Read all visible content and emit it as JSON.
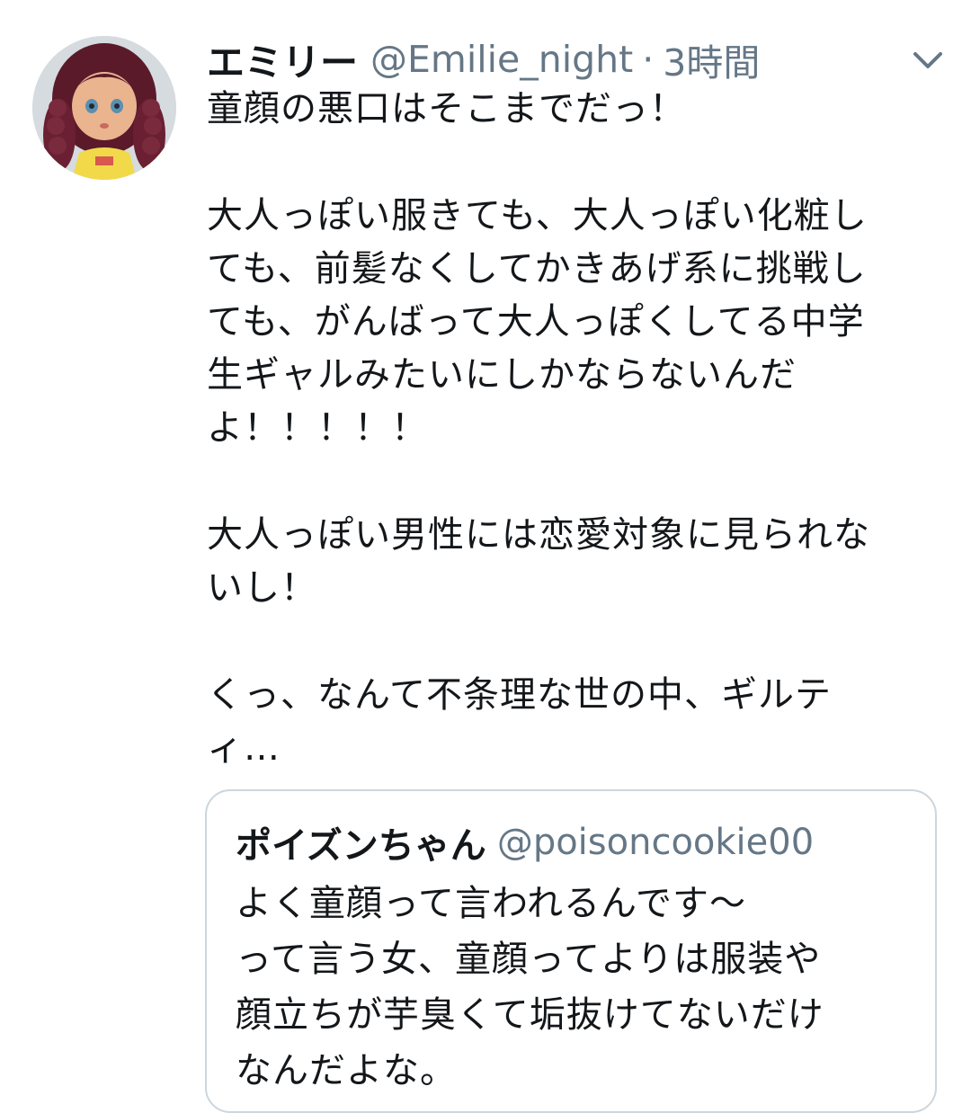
{
  "tweet": {
    "display_name": "エミリー",
    "handle": "@Emilie_night",
    "separator": "·",
    "time": "3時間",
    "avatar_icon": "doll-avatar",
    "menu_icon": "chevron-down-icon",
    "lines": [
      "童顔の悪口はそこまでだっ！",
      "",
      "大人っぽい服きても、大人っぽい化粧し",
      "ても、前髪なくしてかきあげ系に挑戦し",
      "ても、がんばって大人っぽくしてる中学",
      "生ギャルみたいにしかならないんだ",
      "よ！！！！！",
      "",
      "大人っぽい男性には恋愛対象に見られな",
      "いし！",
      "",
      "くっ、なんて不条理な世の中、ギルテ",
      "ィ…"
    ]
  },
  "quoted_tweet": {
    "display_name": "ポイズンちゃん",
    "handle": "@poisoncookie00",
    "lines": [
      "よく童顔って言われるんです〜",
      "って言う女、童顔ってよりは服装や",
      "顔立ちが芋臭くて垢抜けてないだけ",
      "なんだよな。"
    ]
  },
  "colors": {
    "text": "#14171a",
    "secondary": "#657786",
    "border": "#ccd6dd",
    "background": "#ffffff"
  }
}
